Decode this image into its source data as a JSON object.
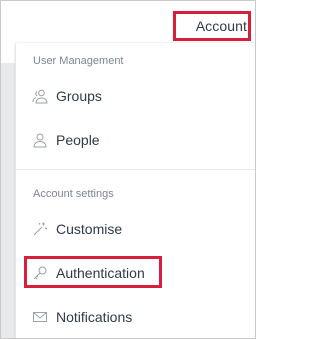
{
  "header": {
    "account_label": "Account"
  },
  "menu": {
    "user_management": {
      "title": "User Management",
      "items": [
        {
          "label": "Groups",
          "icon": "groups-icon"
        },
        {
          "label": "People",
          "icon": "person-icon"
        }
      ]
    },
    "account_settings": {
      "title": "Account settings",
      "items": [
        {
          "label": "Customise",
          "icon": "magic-wand-icon"
        },
        {
          "label": "Authentication",
          "icon": "key-icon"
        },
        {
          "label": "Notifications",
          "icon": "envelope-icon"
        }
      ]
    }
  },
  "colors": {
    "highlight": "#d61f3c",
    "text": "#2f3a48",
    "muted": "#7d8592",
    "icon": "#9aa1ab"
  }
}
